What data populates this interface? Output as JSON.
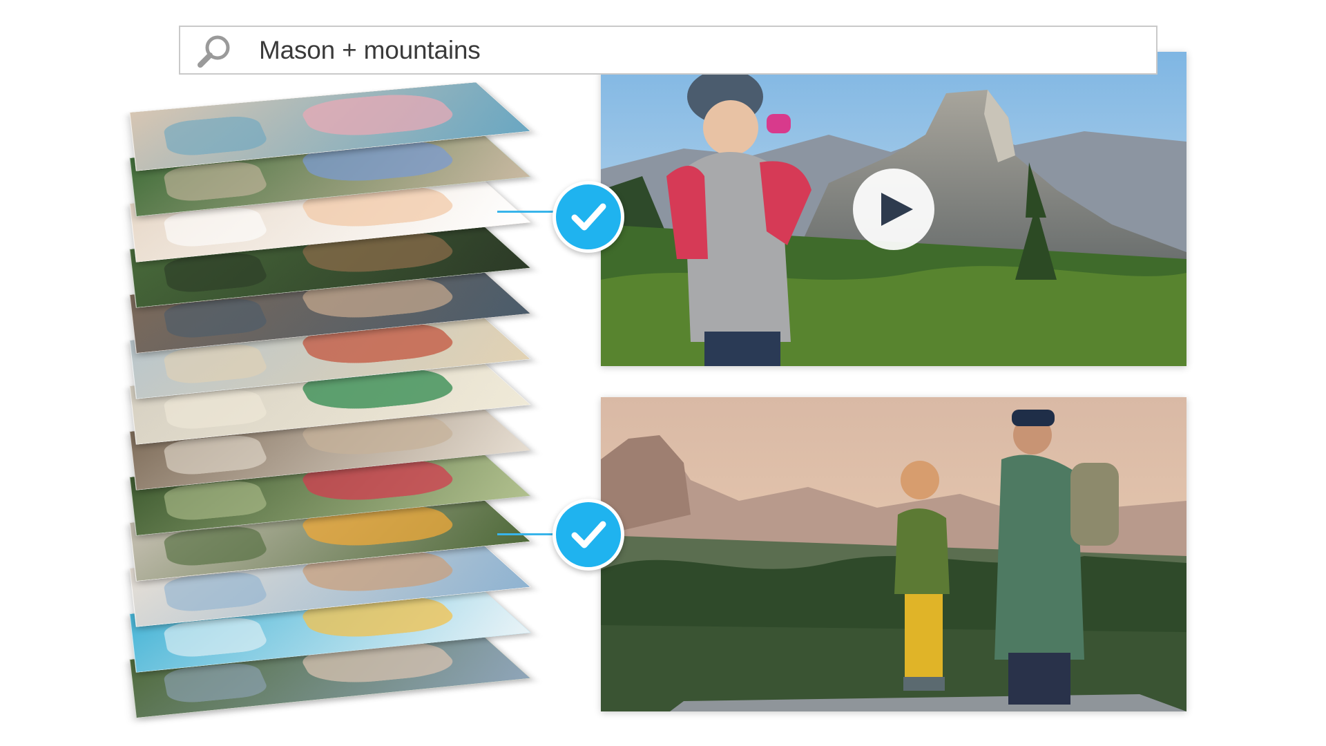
{
  "search": {
    "query": "Mason + mountains",
    "icon": "search-icon"
  },
  "stack": {
    "layers": [
      {
        "a": "#d7c6b3",
        "b": "#e8a9b6",
        "c": "#6aa7c2"
      },
      {
        "a": "#3f6d38",
        "b": "#7b9bd0",
        "c": "#c9b9a2"
      },
      {
        "a": "#e7d8c8",
        "b": "#f2c9a8",
        "c": "#ffffff"
      },
      {
        "a": "#486a3a",
        "b": "#8a6b4a",
        "c": "#2c3a27"
      },
      {
        "a": "#7d6a5a",
        "b": "#c1a58c",
        "c": "#4b5c6b"
      },
      {
        "a": "#b9c6cc",
        "b": "#c3563f",
        "c": "#e2d2b4"
      },
      {
        "a": "#d6d0c2",
        "b": "#2f8a4e",
        "c": "#f0ead8"
      },
      {
        "a": "#7d6b58",
        "b": "#c5b19a",
        "c": "#e6ddd1"
      },
      {
        "a": "#3d5a2f",
        "b": "#d13c4f",
        "c": "#b1c08e"
      },
      {
        "a": "#c9c2b5",
        "b": "#f0a93a",
        "c": "#4f6a3a"
      },
      {
        "a": "#e8e0d6",
        "b": "#caa07d",
        "c": "#8fb3d1"
      },
      {
        "a": "#45b4d6",
        "b": "#f2c14d",
        "c": "#e9f3f7"
      },
      {
        "a": "#4f6a3a",
        "b": "#d7c2b0",
        "c": "#8fa5b9"
      }
    ]
  },
  "matches": [
    {
      "name": "match-video",
      "type": "video",
      "icon": "play-icon"
    },
    {
      "name": "match-photo",
      "type": "photo"
    }
  ],
  "colors": {
    "accent": "#1fb3ef",
    "connector": "#38b4ea"
  }
}
